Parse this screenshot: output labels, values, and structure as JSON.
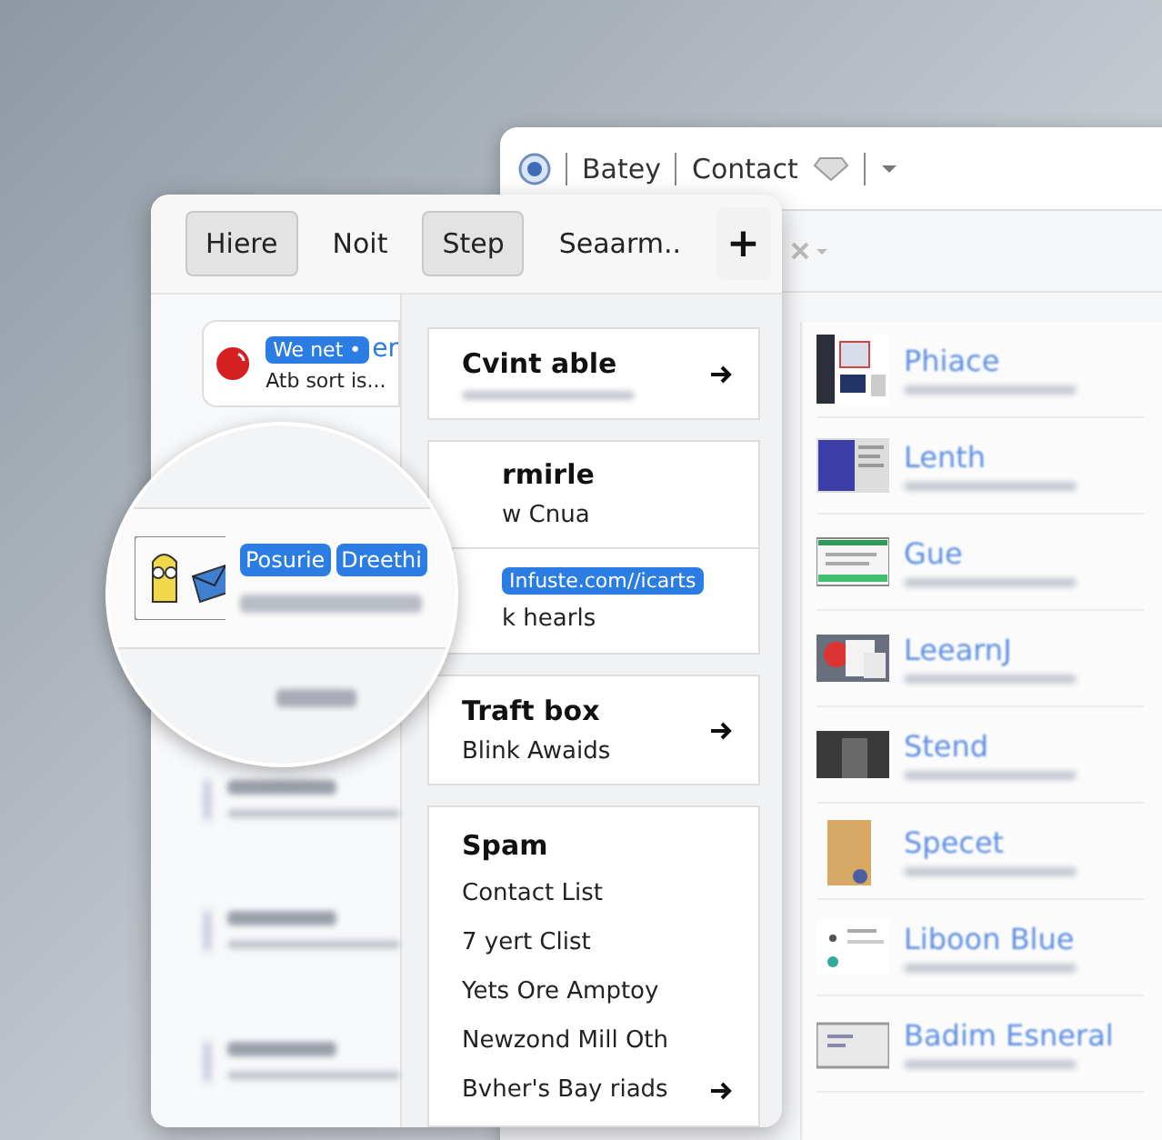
{
  "back_window": {
    "breadcrumbs": [
      "Batey",
      "Contact"
    ],
    "items": [
      {
        "title": "Phiace",
        "kind": "dark-doc"
      },
      {
        "title": "Lenth",
        "kind": "blue-doc"
      },
      {
        "title": "Gue",
        "kind": "green-form"
      },
      {
        "title": "LeearnJ",
        "kind": "red-doc"
      },
      {
        "title": "Stend",
        "kind": "photo"
      },
      {
        "title": "Specet",
        "kind": "tan-book"
      },
      {
        "title": "Liboon Blue",
        "kind": "white-card"
      },
      {
        "title": "Badim Esneral",
        "kind": "folder"
      }
    ]
  },
  "front_window": {
    "tabs": [
      {
        "label": "Hiere",
        "selected": true
      },
      {
        "label": "Noit",
        "selected": false
      },
      {
        "label": "Step",
        "selected": true
      },
      {
        "label": "Seaarm..",
        "selected": false
      }
    ],
    "add_button": "+",
    "message": {
      "badge": "We net •",
      "title": "er",
      "snippet": "Atb sort is..."
    },
    "cards": [
      {
        "kind": "link",
        "title": "Cvint able",
        "arrow": true
      },
      {
        "kind": "detail",
        "title": "rmirle",
        "subtitle": "w Cnua",
        "link": "Infuste.com//icarts",
        "note": "k hearls"
      },
      {
        "kind": "link",
        "title": "Traft box",
        "subtitle": "Blink Awaids",
        "arrow": true
      },
      {
        "kind": "list",
        "title": "Spam",
        "lines": [
          "Contact List",
          "7 yert Clist",
          "Yets Ore Amptoy",
          "Newzond Mill Oth",
          "Bvher's Bay riads"
        ],
        "arrow": true
      }
    ]
  },
  "magnifier": {
    "badges": [
      "Posurie",
      "Dreethi"
    ]
  }
}
